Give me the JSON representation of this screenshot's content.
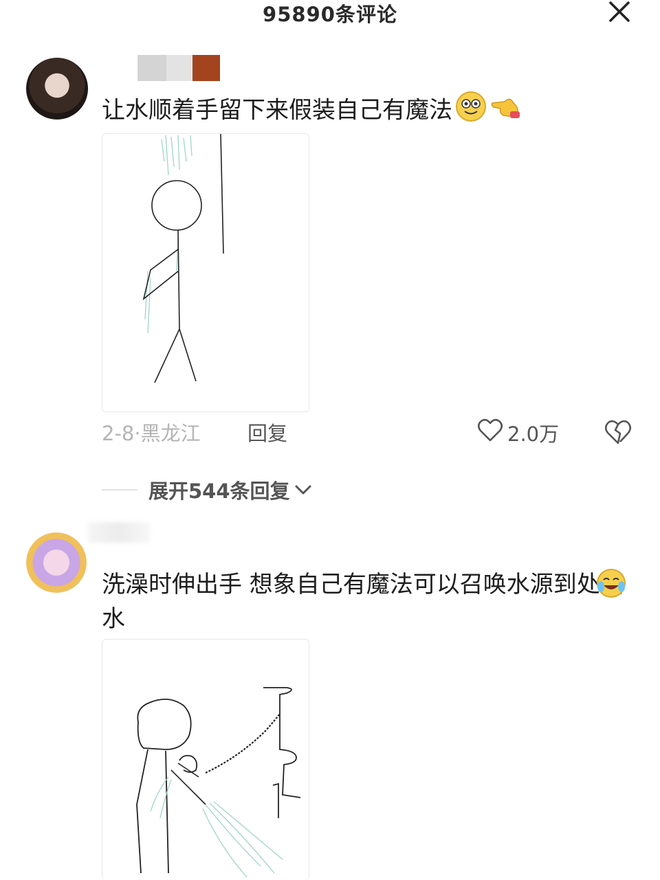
{
  "header": {
    "title": "95890条评论"
  },
  "comments": [
    {
      "text": "让水顺着手留下来假装自己有魔法",
      "date_location": "2-8·黑龙江",
      "reply_label": "回复",
      "likes": "2.0万",
      "expand_label": "展开544条回复"
    },
    {
      "text": "洗澡时伸出手 想象自己有魔法可以召唤水源到处洒水"
    }
  ],
  "colors": {
    "primary_text": "#1d1d1d",
    "secondary_text": "#b4b4b4",
    "action_text": "#555555"
  },
  "icons": {
    "close": "close-icon",
    "like": "heart-icon",
    "dislike": "broken-heart-icon",
    "expand": "chevron-down-icon"
  }
}
